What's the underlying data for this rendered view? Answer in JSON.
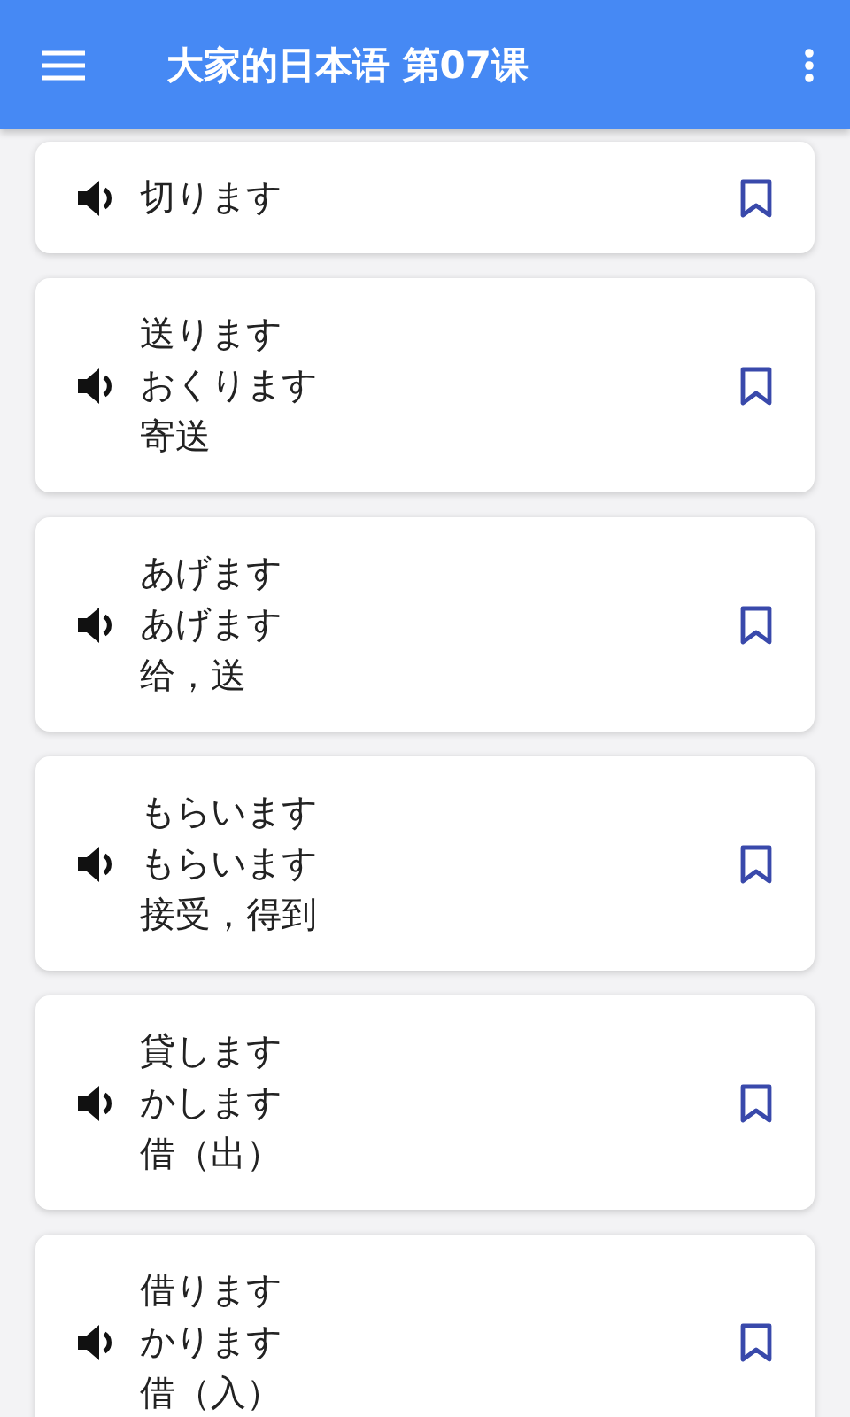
{
  "app_bar": {
    "title": "大家的日本语 第07课"
  },
  "words": [
    {
      "lines": [
        "切ります"
      ],
      "bookmarked": false
    },
    {
      "lines": [
        "送ります",
        "おくります",
        "寄送"
      ],
      "bookmarked": false
    },
    {
      "lines": [
        "あげます",
        "あげます",
        "给，送"
      ],
      "bookmarked": false
    },
    {
      "lines": [
        "もらいます",
        "もらいます",
        "接受，得到"
      ],
      "bookmarked": false
    },
    {
      "lines": [
        "貸します",
        "かします",
        "借（出）"
      ],
      "bookmarked": false
    },
    {
      "lines": [
        "借ります",
        "かります",
        "借（入）"
      ],
      "bookmarked": false
    }
  ]
}
